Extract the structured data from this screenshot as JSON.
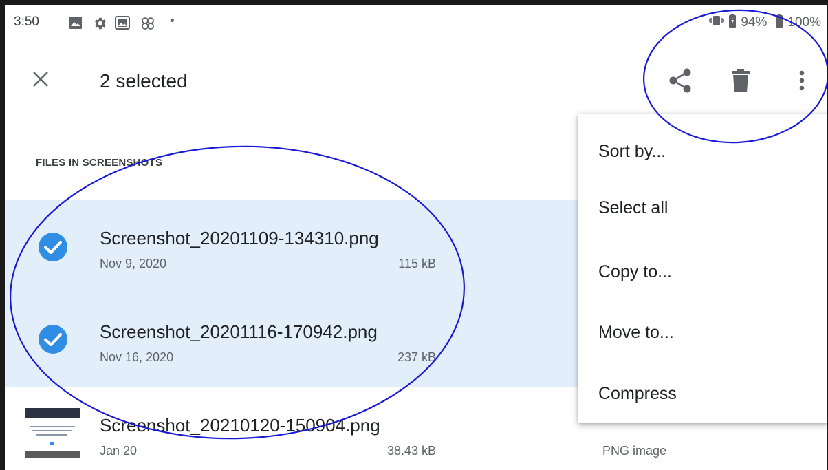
{
  "status_bar": {
    "time": "3:50",
    "dot": "•",
    "battery_a": "94%",
    "battery_b": "100%",
    "icons": [
      "image-icon",
      "settings-gear-icon",
      "gallery-icon",
      "pinwheel-icon",
      "vibrate-icon",
      "battery-icon"
    ]
  },
  "app_bar": {
    "title": "2 selected",
    "actions": [
      "close-icon",
      "share-icon",
      "delete-icon",
      "more-vert-icon"
    ]
  },
  "section": {
    "header": "FILES IN SCREENSHOTS"
  },
  "files": [
    {
      "name": "Screenshot_20201109-134310.png",
      "date": "Nov 9, 2020",
      "size": "115 kB",
      "selected": true
    },
    {
      "name": "Screenshot_20201116-170942.png",
      "date": "Nov 16, 2020",
      "size": "237 kB",
      "selected": true
    },
    {
      "name": "Screenshot_20210120-150904.png",
      "date": "Jan 20",
      "size": "38.43 kB",
      "type": "PNG image",
      "selected": false
    }
  ],
  "menu": {
    "items": [
      "Sort by...",
      "Select all",
      "Copy to...",
      "Move to...",
      "Compress"
    ]
  },
  "colors": {
    "selected_background": "#e2effb",
    "check_blue": "#2f8de4",
    "annotation_blue": "#1a1ad6",
    "icon_gray": "#5f6368"
  }
}
